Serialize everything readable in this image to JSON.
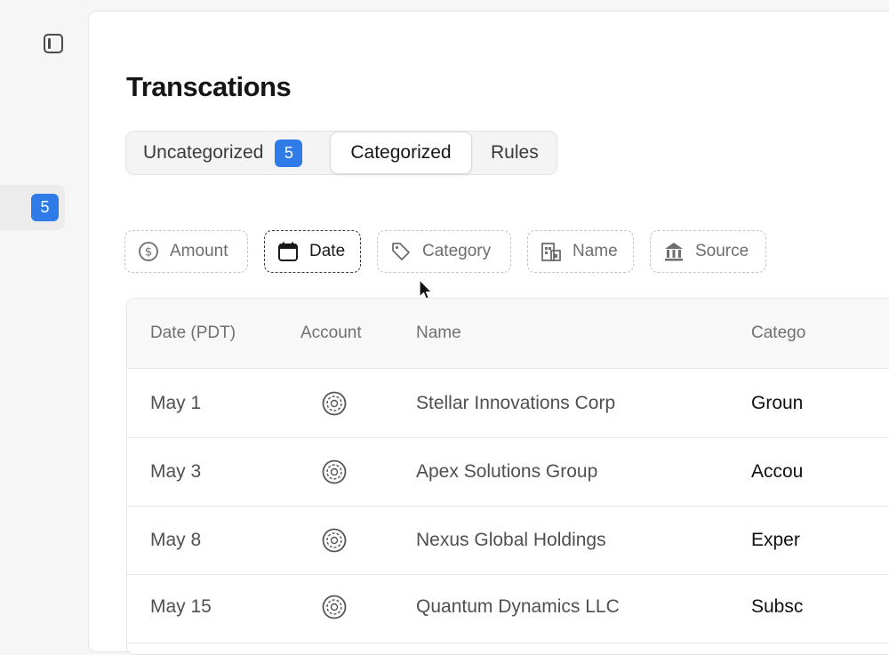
{
  "sidebar": {
    "toggle_icon": "sidebar-toggle-icon",
    "badge_count": "5"
  },
  "page": {
    "title": "Transcations"
  },
  "tabs": [
    {
      "label": "Uncategorized",
      "badge": "5"
    },
    {
      "label": "Categorized"
    },
    {
      "label": "Rules"
    }
  ],
  "active_tab": "Categorized",
  "filters": [
    {
      "label": "Amount",
      "icon": "dollar-circle-icon"
    },
    {
      "label": "Date",
      "icon": "calendar-icon"
    },
    {
      "label": "Category",
      "icon": "tag-icon"
    },
    {
      "label": "Name",
      "icon": "building-icon"
    },
    {
      "label": "Source",
      "icon": "bank-icon"
    }
  ],
  "table": {
    "columns": [
      "Date (PDT)",
      "Account",
      "Name",
      "Catego"
    ],
    "rows": [
      {
        "date": "May 1",
        "account_icon": "account-logo-icon",
        "name": "Stellar Innovations Corp",
        "category": "Groun"
      },
      {
        "date": "May 3",
        "account_icon": "account-logo-icon",
        "name": "Apex Solutions Group",
        "category": "Accou"
      },
      {
        "date": "May 8",
        "account_icon": "account-logo-icon",
        "name": "Nexus Global Holdings",
        "category": "Exper"
      },
      {
        "date": "May 15",
        "account_icon": "account-logo-icon",
        "name": "Quantum Dynamics LLC",
        "category": "Subsc"
      }
    ]
  },
  "colors": {
    "accent": "#2f7be8",
    "background": "#f6f6f6",
    "panel": "#ffffff"
  }
}
